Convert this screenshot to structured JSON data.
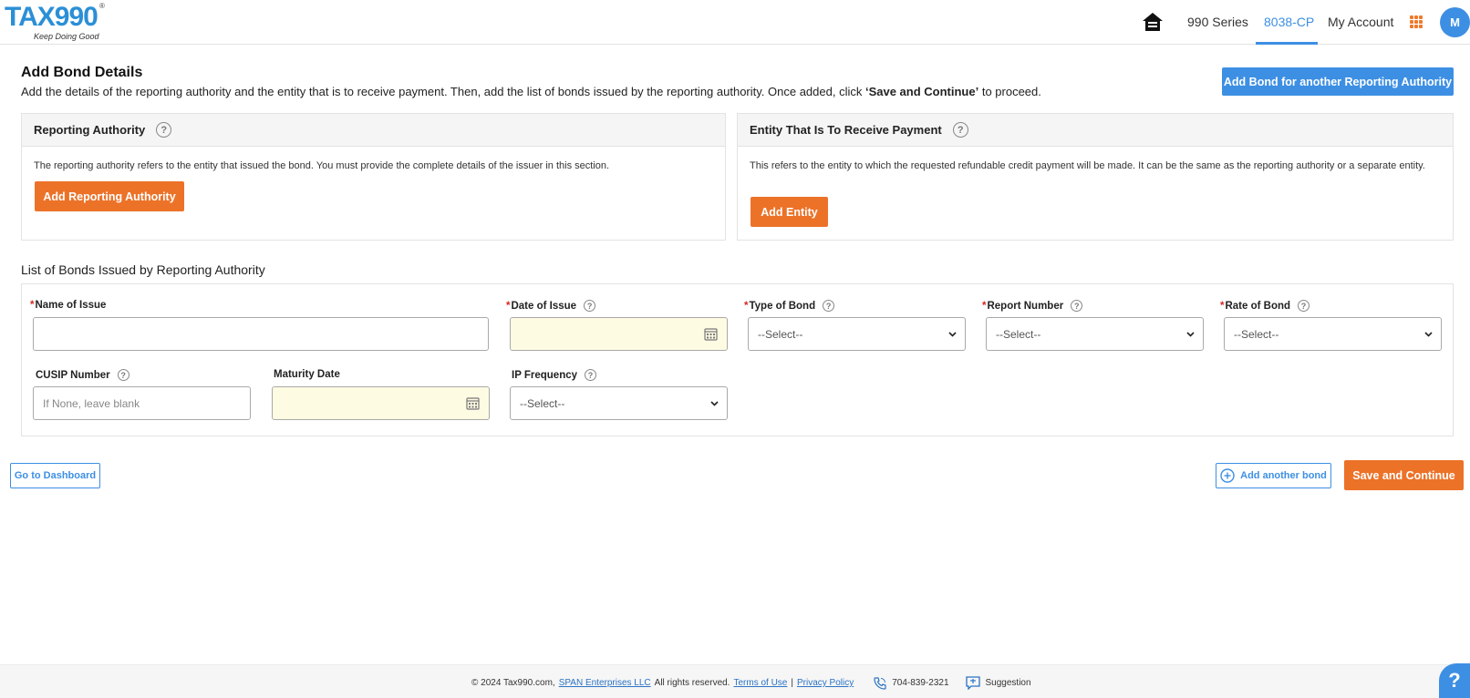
{
  "header": {
    "logo_text": "TAX990",
    "logo_reg": "®",
    "logo_tagline": "Keep Doing Good",
    "nav": [
      {
        "label": "990 Series",
        "active": false
      },
      {
        "label": "8038-CP",
        "active": true
      },
      {
        "label": "My Account",
        "active": false
      }
    ],
    "avatar_initial": "M",
    "accent_color": "#3d8fe3",
    "apps_icon": "grid-icon"
  },
  "page": {
    "title": "Add Bond Details",
    "desc_pre": "Add the details of the reporting authority and the entity that is to receive payment. Then, add the list of bonds issued by the reporting authority. Once added, click ",
    "desc_bold": "‘Save and Continue’",
    "desc_post": " to proceed.",
    "add_authority_button": "Add Bond for another Reporting Authority"
  },
  "reporting_authority": {
    "title": "Reporting Authority",
    "text": "The reporting authority refers to the entity that issued the bond. You must provide the complete details of the issuer in this section.",
    "button": "Add Reporting Authority"
  },
  "entity": {
    "title": "Entity That Is To Receive Payment",
    "text": "This refers to the entity to which the requested refundable credit payment will be made. It can be the same as the reporting authority or a separate entity.",
    "button": "Add Entity"
  },
  "bonds": {
    "section_title": "List of Bonds Issued by Reporting Authority",
    "fields": {
      "name_of_issue": {
        "label": "Name of Issue",
        "required": "*",
        "value": ""
      },
      "date_of_issue": {
        "label": "Date of Issue",
        "required": "*",
        "value": ""
      },
      "type_of_bond": {
        "label": "Type of Bond",
        "required": "*",
        "value": "--Select--"
      },
      "report_number": {
        "label": "Report Number",
        "required": "*",
        "value": "--Select--"
      },
      "rate_of_bond": {
        "label": "Rate of Bond",
        "required": "*",
        "value": "--Select--"
      },
      "cusip_number": {
        "label": "CUSIP Number",
        "placeholder": "If None, leave blank"
      },
      "maturity_date": {
        "label": "Maturity Date",
        "value": ""
      },
      "ip_frequency": {
        "label": "IP Frequency",
        "value": "--Select--"
      }
    }
  },
  "actions": {
    "dashboard": "Go to Dashboard",
    "add_bond": "Add another bond",
    "save": "Save and Continue"
  },
  "footer": {
    "copyright": "© 2024 Tax990.com,",
    "company_link": "SPAN Enterprises LLC",
    "rights": "All rights reserved.",
    "terms": "Terms of Use",
    "separator": "|",
    "privacy": "Privacy Policy",
    "phone": "704-839-2321",
    "suggestion": "Suggestion",
    "help_fab": "?"
  }
}
